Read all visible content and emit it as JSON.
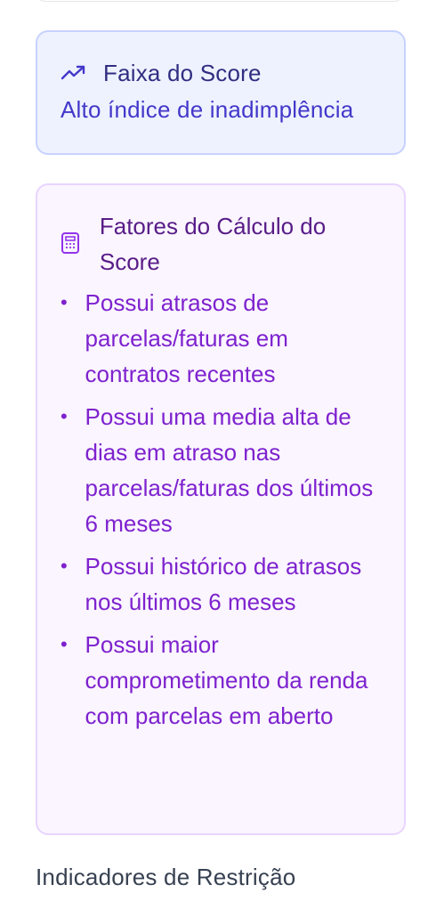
{
  "score_range": {
    "icon": "trending-up-icon",
    "title": "Faixa do Score",
    "value": "Alto índice de inadimplência",
    "accent_color": "#4338ca"
  },
  "score_factors": {
    "icon": "calculator-icon",
    "title": "Fatores do Cálculo do Score",
    "bullet": "•",
    "items": [
      {
        "text": "Possui atrasos de parcelas/faturas em contratos recentes"
      },
      {
        "text": "Possui uma media alta de dias em atraso nas parcelas/faturas dos últimos 6 meses"
      },
      {
        "text": "Possui histórico de atrasos nos últimos 6 meses"
      },
      {
        "text": "Possui maior comprometimento da renda com parcelas em aberto"
      }
    ],
    "accent_color": "#7e22ce"
  },
  "restriction_indicators": {
    "title": "Indicadores de Restrição"
  }
}
